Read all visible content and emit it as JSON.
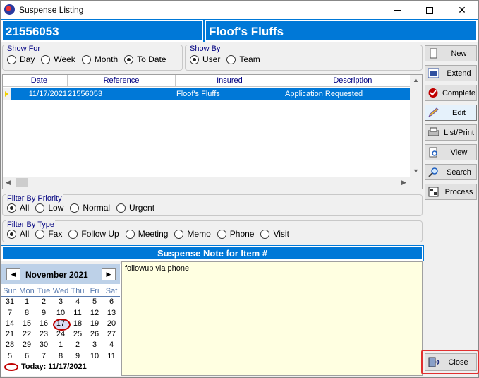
{
  "window": {
    "title": "Suspense Listing"
  },
  "header": {
    "number": "21556053",
    "name": "Floof's Fluffs"
  },
  "show_for": {
    "label": "Show For",
    "options": [
      "Day",
      "Week",
      "Month",
      "To Date"
    ],
    "selected": "To Date"
  },
  "show_by": {
    "label": "Show By",
    "options": [
      "User",
      "Team"
    ],
    "selected": "User"
  },
  "grid": {
    "columns": [
      "Date",
      "Reference",
      "Insured",
      "Description"
    ],
    "rows": [
      {
        "date": "11/17/2021",
        "reference": "21556053",
        "insured": "Floof's Fluffs",
        "description": "Application Requested"
      }
    ]
  },
  "buttons": {
    "new": "New",
    "extend": "Extend",
    "complete": "Complete",
    "edit": "Edit",
    "list_print": "List/Print",
    "view": "View",
    "search": "Search",
    "process": "Process",
    "close": "Close"
  },
  "filter_priority": {
    "label": "Filter By Priority",
    "options": [
      "All",
      "Low",
      "Normal",
      "Urgent"
    ],
    "selected": "All"
  },
  "filter_type": {
    "label": "Filter By Type",
    "options": [
      "All",
      "Fax",
      "Follow Up",
      "Meeting",
      "Memo",
      "Phone",
      "Visit"
    ],
    "selected": "All"
  },
  "note": {
    "title": "Suspense Note for Item #",
    "text": "followup via phone"
  },
  "calendar": {
    "month_label": "November 2021",
    "days_of_week": [
      "Sun",
      "Mon",
      "Tue",
      "Wed",
      "Thu",
      "Fri",
      "Sat"
    ],
    "weeks": [
      [
        "31",
        "1",
        "2",
        "3",
        "4",
        "5",
        "6"
      ],
      [
        "7",
        "8",
        "9",
        "10",
        "11",
        "12",
        "13"
      ],
      [
        "14",
        "15",
        "16",
        "17",
        "18",
        "19",
        "20"
      ],
      [
        "21",
        "22",
        "23",
        "24",
        "25",
        "26",
        "27"
      ],
      [
        "28",
        "29",
        "30",
        "1",
        "2",
        "3",
        "4"
      ],
      [
        "5",
        "6",
        "7",
        "8",
        "9",
        "10",
        "11"
      ]
    ],
    "today_day": "17",
    "today_label": "Today: 11/17/2021"
  }
}
